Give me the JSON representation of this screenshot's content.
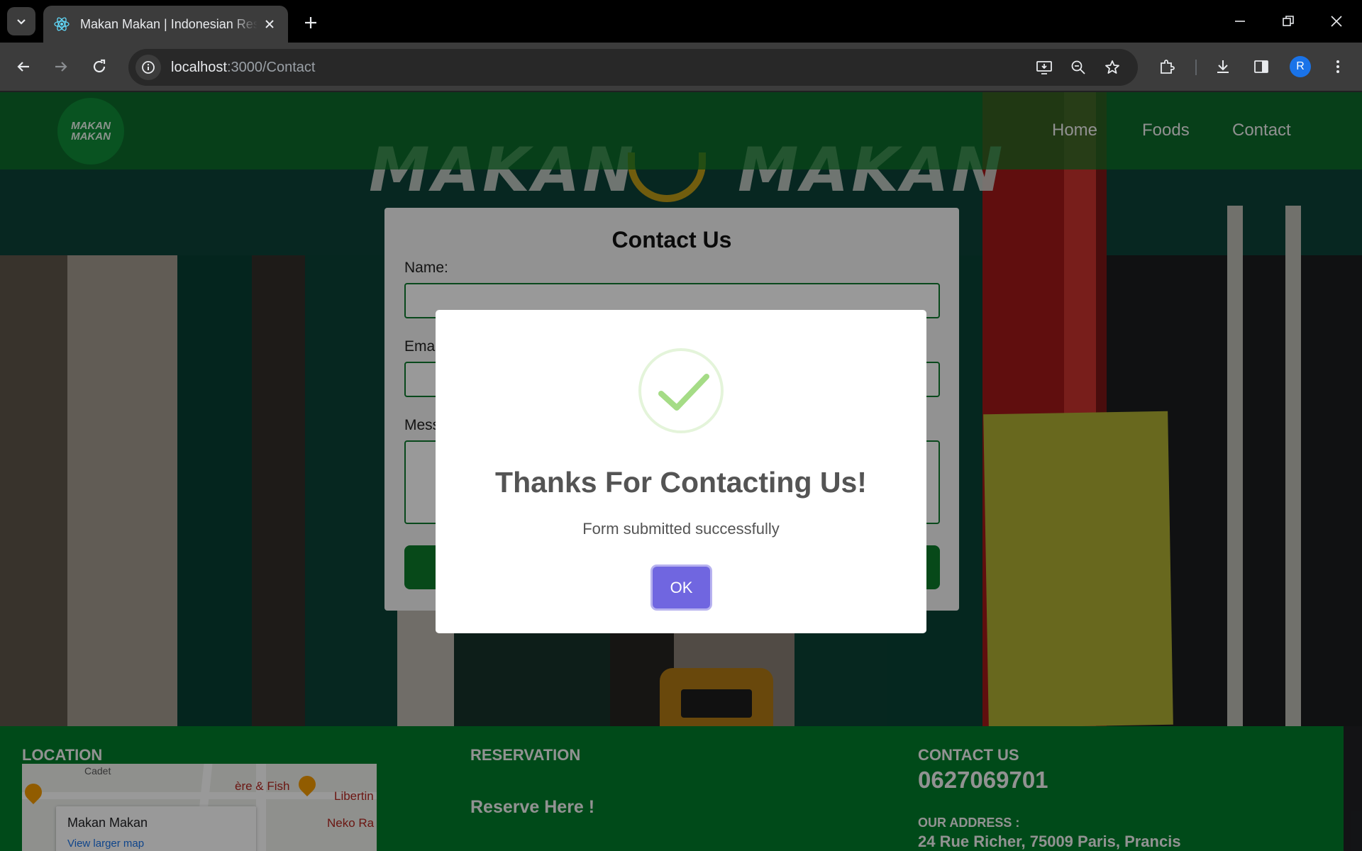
{
  "browser": {
    "tab_title": "Makan Makan | Indonesian Restaurant",
    "url_host": "localhost",
    "url_path": ":3000/Contact",
    "profile_initial": "R"
  },
  "site": {
    "logo_line1": "MAKAN",
    "logo_line2": "MAKAN",
    "hero_sign_left": "MAKAN",
    "hero_sign_right": "MAKAN",
    "nav": {
      "home": "Home",
      "foods": "Foods",
      "contact": "Contact"
    }
  },
  "form": {
    "title": "Contact Us",
    "name_label": "Name:",
    "email_label": "Email:",
    "message_label": "Message:"
  },
  "footer": {
    "location_title": "LOCATION",
    "map": {
      "place_name": "Makan Makan",
      "larger_map_link": "View larger map",
      "poi_1": "ère & Fish",
      "poi_2": "Libertin",
      "poi_3": "Neko Ra",
      "poi_4": "Cadet"
    },
    "reservation_title": "RESERVATION",
    "reserve_link": "Reserve Here !",
    "contact_title": "CONTACT US",
    "phone": "0627069701",
    "address_label": "OUR ADDRESS :",
    "address": "24 Rue Richer, 75009 Paris, Prancis"
  },
  "modal": {
    "title": "Thanks For Contacting Us!",
    "text": "Form submitted successfully",
    "ok_label": "OK",
    "icon": "success-check-icon"
  },
  "colors": {
    "brand_green": "#007c2a",
    "confirm_button": "#7066e0",
    "success_check": "#a5dc86"
  }
}
